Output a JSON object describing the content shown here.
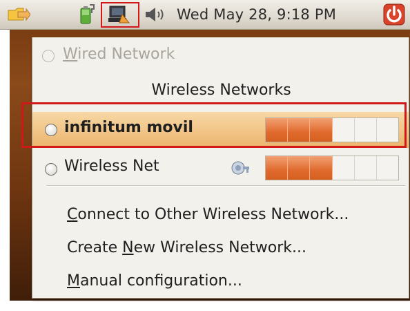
{
  "panel": {
    "clock": "Wed May 28,  9:18 PM",
    "icons": [
      "folder-arrow-icon",
      "battery-power-icon",
      "network-manager-icon",
      "volume-icon",
      "power-icon"
    ]
  },
  "menu": {
    "wired": {
      "accel": "W",
      "rest": "ired Network",
      "enabled": false
    },
    "section_title": "Wireless Networks",
    "networks": [
      {
        "name": "infinitum movil",
        "selected": true,
        "bold": true,
        "signal_segments_on": 3,
        "signal_segments_total": 6,
        "encrypted": false
      },
      {
        "name": "Wireless Net",
        "selected": false,
        "bold": false,
        "signal_segments_on": 3,
        "signal_segments_total": 6,
        "encrypted": true
      }
    ],
    "actions": [
      {
        "accel": "C",
        "rest": "onnect to Other Wireless Network..."
      },
      {
        "pre": "Create ",
        "accel": "N",
        "rest": "ew Wireless Network..."
      },
      {
        "accel": "M",
        "rest": "anual configuration..."
      }
    ]
  },
  "colors": {
    "highlight_red": "#d01818",
    "signal_orange": "#e06a2d",
    "row_highlight": "#ecb46c",
    "desktop_brown": "#7a3d12"
  }
}
